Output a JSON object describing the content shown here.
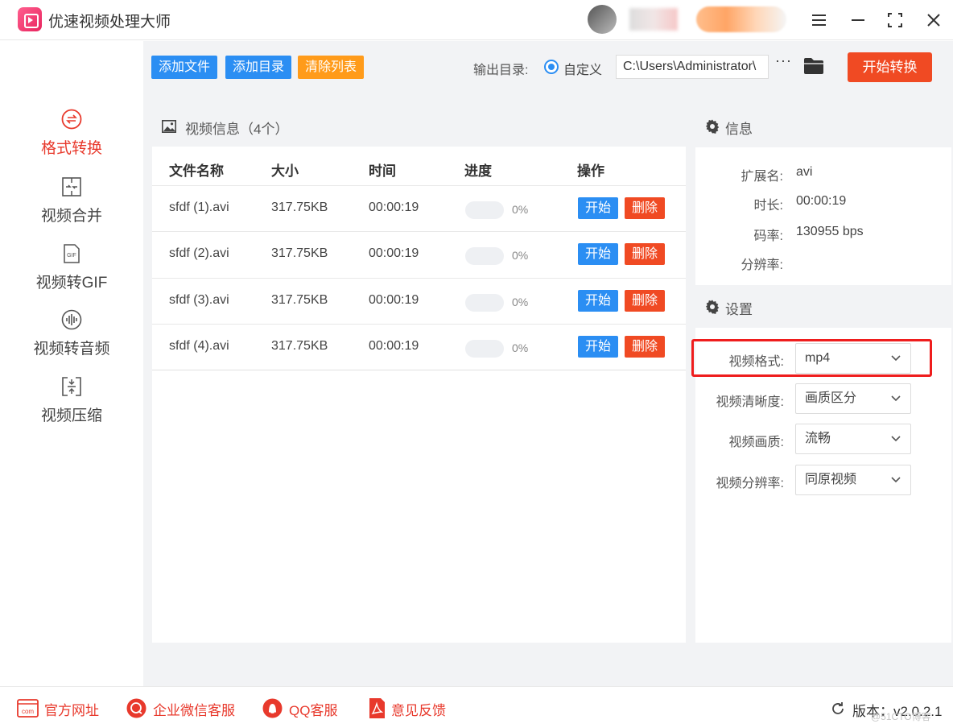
{
  "app": {
    "title": "优速视频处理大师"
  },
  "window_controls": [
    "menu-icon",
    "minimize-icon",
    "maximize-icon",
    "close-icon"
  ],
  "sidebar": {
    "items": [
      {
        "label": "格式转换",
        "icon": "format-convert-icon",
        "active": true
      },
      {
        "label": "视频合并",
        "icon": "merge-icon",
        "active": false
      },
      {
        "label": "视频转GIF",
        "icon": "gif-icon",
        "icon_text": "GIF",
        "active": false
      },
      {
        "label": "视频转音频",
        "icon": "audio-icon",
        "active": false
      },
      {
        "label": "视频压缩",
        "icon": "compress-icon",
        "active": false
      }
    ]
  },
  "toolbar": {
    "add_file": "添加文件",
    "add_dir": "添加目录",
    "clear_list": "清除列表",
    "output_label": "输出目录:",
    "custom_label": "自定义",
    "output_path": "C:\\Users\\Administrator\\",
    "more": "···",
    "start_convert": "开始转换"
  },
  "video_list": {
    "title": "视频信息（4个）",
    "columns": {
      "name": "文件名称",
      "size": "大小",
      "time": "时间",
      "progress": "进度",
      "action": "操作"
    },
    "start_label": "开始",
    "delete_label": "删除",
    "rows": [
      {
        "name": "sfdf (1).avi",
        "size": "317.75KB",
        "time": "00:00:19",
        "progress": "0%"
      },
      {
        "name": "sfdf (2).avi",
        "size": "317.75KB",
        "time": "00:00:19",
        "progress": "0%"
      },
      {
        "name": "sfdf (3).avi",
        "size": "317.75KB",
        "time": "00:00:19",
        "progress": "0%"
      },
      {
        "name": "sfdf (4).avi",
        "size": "317.75KB",
        "time": "00:00:19",
        "progress": "0%"
      }
    ]
  },
  "info": {
    "title": "信息",
    "ext_label": "扩展名:",
    "ext_value": "avi",
    "duration_label": "时长:",
    "duration_value": "00:00:19",
    "bitrate_label": "码率:",
    "bitrate_value": "130955 bps",
    "resolution_label": "分辨率:",
    "resolution_value": ""
  },
  "settings": {
    "title": "设置",
    "format_label": "视频格式:",
    "format_value": "mp4",
    "clarity_label": "视频清晰度:",
    "clarity_value": "画质区分",
    "quality_label": "视频画质:",
    "quality_value": "流畅",
    "resolution_label": "视频分辨率:",
    "resolution_value": "同原视频"
  },
  "footer": {
    "website": "官方网址",
    "wechat": "企业微信客服",
    "qq": "QQ客服",
    "feedback": "意见反馈",
    "version": "版本：v2.0.2.1",
    "watermark": "@51CTO博客"
  },
  "colors": {
    "accent_red": "#e8392c",
    "button_blue": "#2b8ef3",
    "button_orange": "#ff9b1a",
    "start_red": "#f04a23",
    "highlight_box": "#ef1d1d"
  }
}
